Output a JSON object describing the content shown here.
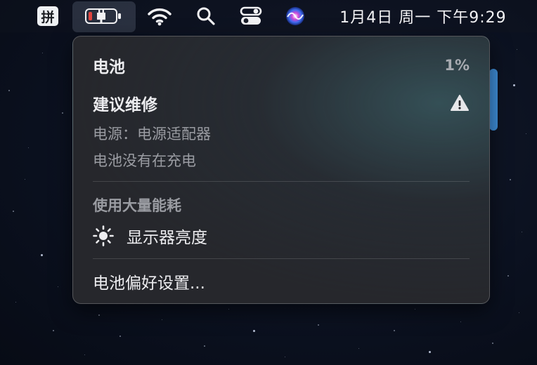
{
  "menubar": {
    "input_method_label": "拼",
    "battery_icon": "battery-low-charging-icon",
    "wifi_icon": "wifi-icon",
    "search_icon": "search-icon",
    "control_center_icon": "control-center-icon",
    "siri_icon": "siri-icon",
    "clock": "1月4日 周一 下午9:29"
  },
  "battery_menu": {
    "title": "电池",
    "percentage": "1%",
    "condition": "建议维修",
    "power_source": "电源：电源适配器",
    "charging_status": "电池没有在充电",
    "significant_energy_label": "使用大量能耗",
    "energy_items": [
      {
        "label": "显示器亮度",
        "icon": "sun-icon"
      }
    ],
    "preferences_label": "电池偏好设置..."
  },
  "colors": {
    "battery_low": "#e0443e",
    "battery_charge": "#ffffff",
    "scroll_accent": "#3f8fd9"
  }
}
